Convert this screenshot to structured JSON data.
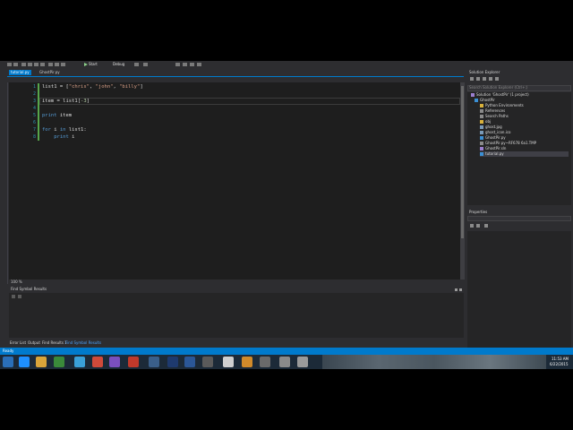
{
  "toolbar": {
    "start_label": "Start",
    "config_label": "Debug"
  },
  "tabs": [
    {
      "label": "tutorial.py",
      "active": true
    },
    {
      "label": "GhostPir.py",
      "active": false
    }
  ],
  "editor": {
    "zoom": "100 %",
    "line_numbers": [
      "1",
      "2",
      "3",
      "4",
      "5",
      "6",
      "7",
      "8"
    ],
    "lines": [
      {
        "line": "1",
        "text": "list1 = [\"chris\", \"john\", \"billy\"]"
      },
      {
        "line": "2",
        "text": ""
      },
      {
        "line": "3",
        "text": "item = list1[-3]"
      },
      {
        "line": "4",
        "text": ""
      },
      {
        "line": "5",
        "text": "print item"
      },
      {
        "line": "6",
        "text": ""
      },
      {
        "line": "7",
        "text": "for i in list1:"
      },
      {
        "line": "8",
        "text": "    print i"
      }
    ]
  },
  "find_symbol": {
    "title": "Find Symbol Results",
    "bottom_tabs": [
      "Error List",
      "Output",
      "Find Results 1",
      "Find Symbol Results"
    ]
  },
  "solution_explorer": {
    "title": "Solution Explorer",
    "search_placeholder": "Search Solution Explorer (Ctrl+;)",
    "items": [
      {
        "label": "Solution 'GhostPir' (1 project)",
        "indent": 0
      },
      {
        "label": "GhostPir",
        "indent": 1
      },
      {
        "label": "Python Environments",
        "indent": 2
      },
      {
        "label": "References",
        "indent": 2
      },
      {
        "label": "Search Paths",
        "indent": 2
      },
      {
        "label": "obj",
        "indent": 2
      },
      {
        "label": "ghost.jpg",
        "indent": 2
      },
      {
        "label": "ghost_icon.ico",
        "indent": 2
      },
      {
        "label": "GhostPir.py",
        "indent": 2
      },
      {
        "label": "GhostPir.py~RF678 6a1.TMP",
        "indent": 2
      },
      {
        "label": "GhostPir.sln",
        "indent": 2
      },
      {
        "label": "tutorial.py",
        "indent": 2
      }
    ]
  },
  "properties": {
    "title": "Properties"
  },
  "status": {
    "text": "Ready"
  },
  "taskbar": {
    "time": "11:53 AM",
    "date": "6/22/2015"
  },
  "colors": {
    "accent": "#007acc",
    "editor_bg": "#1e1e1e",
    "chrome_bg": "#2d2d30",
    "keyword": "#569cd6",
    "string": "#d69d85",
    "taskbar": "#1c2a38"
  }
}
